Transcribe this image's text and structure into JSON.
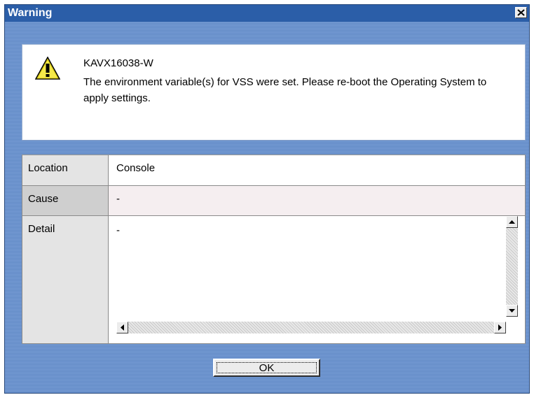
{
  "window": {
    "title": "Warning",
    "close_symbol": "✕"
  },
  "message": {
    "icon": "warning-icon",
    "code": "KAVX16038-W",
    "text": "The environment variable(s) for VSS were set. Please re-boot the Operating System to apply settings."
  },
  "details": {
    "location_label": "Location",
    "location_value": "Console",
    "cause_label": "Cause",
    "cause_value": "-",
    "detail_label": "Detail",
    "detail_value": "-"
  },
  "buttons": {
    "ok_label": "OK"
  },
  "colors": {
    "titlebar": "#2b5ea8",
    "warning_yellow": "#f5e94a"
  }
}
